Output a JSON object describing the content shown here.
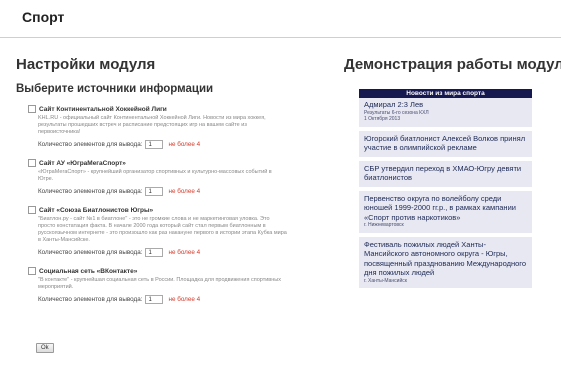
{
  "page": {
    "title": "Спорт"
  },
  "settings": {
    "heading": "Настройки модуля",
    "subheading": "Выберите источники информации",
    "sources": [
      {
        "name": "Сайт Континентальной Хоккейной Лиги",
        "description": "KHL.RU - официальный сайт Континентальной Хоккейной Лиги. Новости из мира хоккея, результаты прошедших встреч и расписание предстоящих игр на вашем сайте из первоисточника!",
        "count_label": "Количество элементов для вывода:",
        "count_value": "1",
        "count_note": "не более 4"
      },
      {
        "name": "Сайт АУ «ЮграМегаСпорт»",
        "description": "«ЮграМегаСпорт» - крупнейший организатор спортивных и культурно-массовых событий в Югре.",
        "count_label": "Количество элементов для вывода:",
        "count_value": "1",
        "count_note": "не более 4"
      },
      {
        "name": "Сайт «Союза Биатлонистов Югры»",
        "description": "\"Биатлон.ру - сайт №1 в биатлоне\" - это не громкие слова и не маркетинговая уловка. Это просто констатация факта. В начале 2000 года который сайт стал первым биатлонным в русскоязычном интернете - это произошло как раз накануне первого в истории этапа Кубка мира в Ханты-Мансийске.",
        "count_label": "Количество элементов для вывода:",
        "count_value": "1",
        "count_note": "не более 4"
      },
      {
        "name": "Социальная сеть «ВКонтакте»",
        "description": "\"В контакте\" - крупнейшая социальная сеть в России. Площадка для продвижения спортивных мероприятий.",
        "count_label": "Количество элементов для вывода:",
        "count_value": "1",
        "count_note": "не более 4"
      }
    ],
    "ok_label": "Ok"
  },
  "demo": {
    "heading": "Демонстрация работы модуля",
    "widget_title": "Новости из мира спорта",
    "news": [
      {
        "title": "Адмирал 2:3 Лев",
        "meta": "Результаты 6-го сезона КХЛ",
        "meta2": "1 Октября 2013"
      },
      {
        "title": "Югорский биатлонист Алексей Волков принял участие в олимпийской рекламе",
        "meta": "",
        "meta2": ""
      },
      {
        "title": "СБР утвердил переход в ХМАО-Югру девяти биатлонистов",
        "meta": "",
        "meta2": ""
      },
      {
        "title": "Первенство округа по волейболу среди юношей 1999-2000 гг.р., в рамках кампании «Спорт против наркотиков»",
        "meta": "г. Нижневартовск",
        "meta2": ""
      },
      {
        "title": "Фестиваль пожилых людей Ханты-Мансийского автономного округа - Югры, посвященный празднованию Международного дня пожилых людей",
        "meta": "г. Ханты-Мансийск",
        "meta2": ""
      }
    ]
  }
}
